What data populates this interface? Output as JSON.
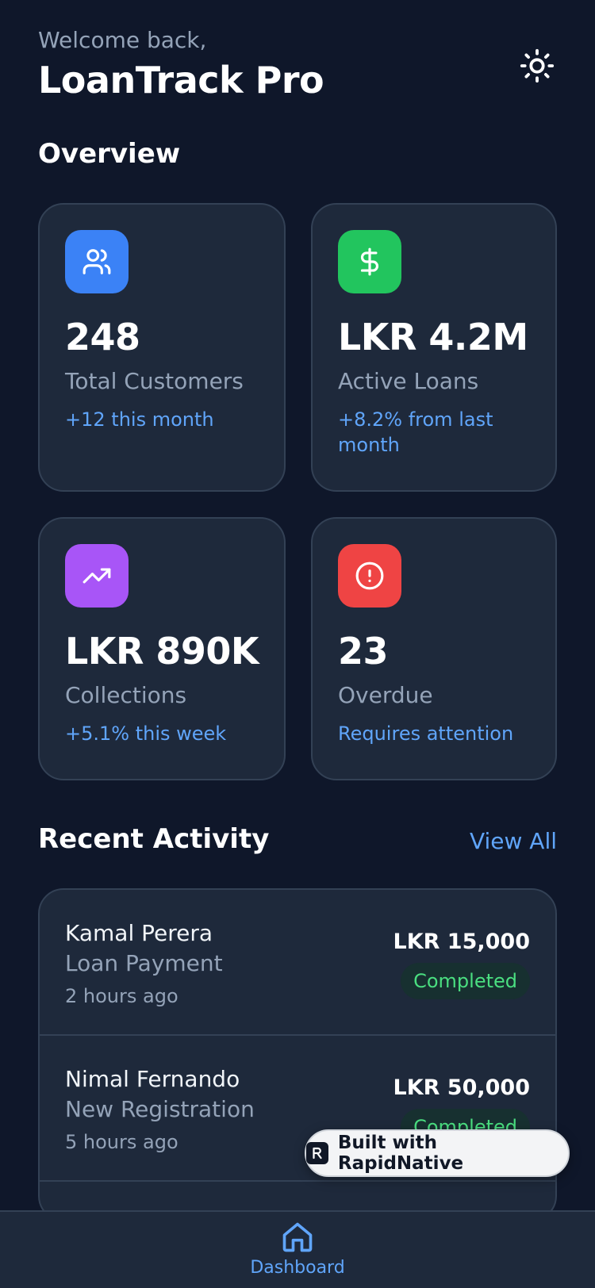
{
  "header": {
    "greeting": "Welcome back,",
    "app_title": "LoanTrack Pro",
    "theme_icon": "sun-icon"
  },
  "overview": {
    "title": "Overview",
    "cards": [
      {
        "icon": "users-icon",
        "color": "#3b82f6",
        "value": "248",
        "label": "Total Customers",
        "sub": "+12 this month"
      },
      {
        "icon": "dollar-icon",
        "color": "#22c55e",
        "value": "LKR 4.2M",
        "label": "Active Loans",
        "sub": "+8.2% from last month"
      },
      {
        "icon": "trending-up-icon",
        "color": "#a855f7",
        "value": "LKR 890K",
        "label": "Collections",
        "sub": "+5.1% this week"
      },
      {
        "icon": "alert-circle-icon",
        "color": "#ef4444",
        "value": "23",
        "label": "Overdue",
        "sub": "Requires attention"
      }
    ]
  },
  "activity": {
    "title": "Recent Activity",
    "view_all": "View All",
    "items": [
      {
        "name": "Kamal Perera",
        "type": "Loan Payment",
        "time": "2 hours ago",
        "amount": "LKR 15,000",
        "status": "Completed"
      },
      {
        "name": "Nimal Fernando",
        "type": "New Registration",
        "time": "5 hours ago",
        "amount": "LKR 50,000",
        "status": "Completed"
      }
    ]
  },
  "badge": {
    "label": "Built with RapidNative"
  },
  "tabbar": {
    "home_label": "Dashboard",
    "home_icon": "home-icon"
  },
  "colors": {
    "background": "#0f172a",
    "card": "#1e293b",
    "accent": "#60a5fa",
    "success": "#4ade80"
  }
}
